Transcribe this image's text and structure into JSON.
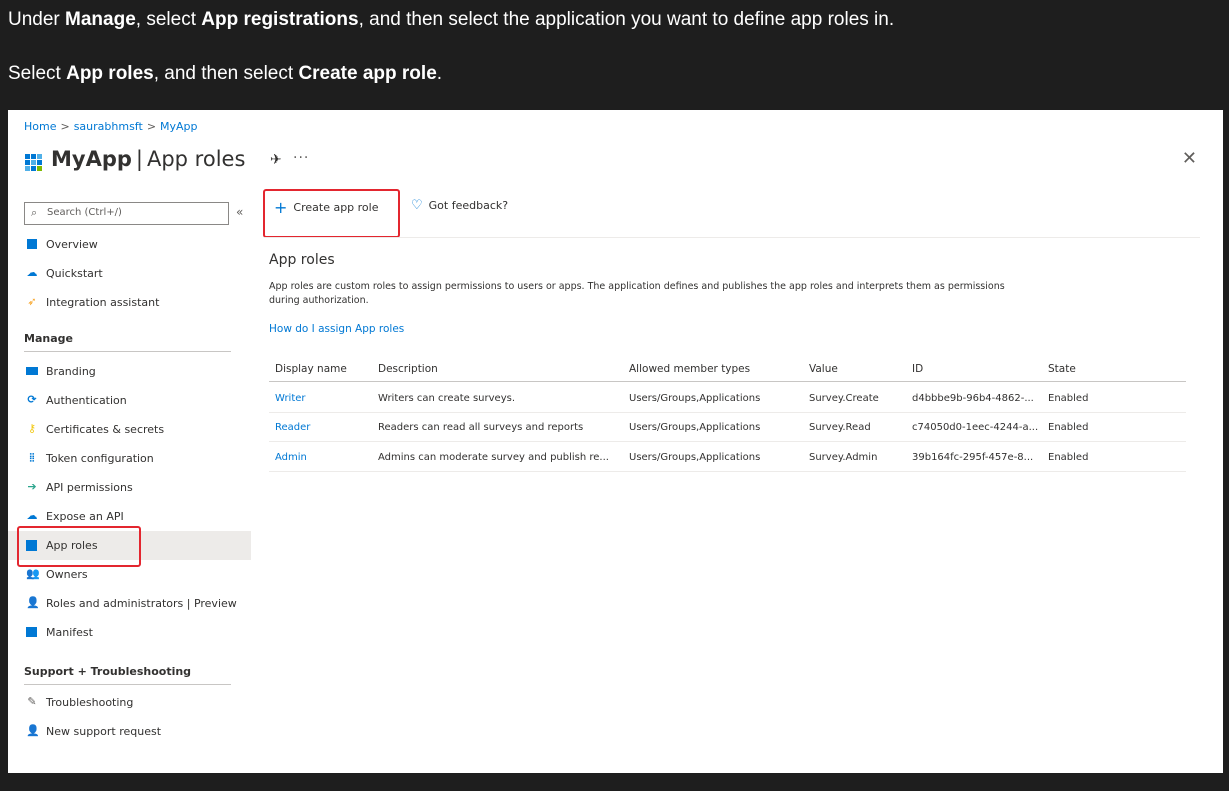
{
  "instructions": {
    "line1": {
      "p1": "Under ",
      "b1": "Manage",
      "p2": ", select ",
      "b2": "App registrations",
      "p3": ", and then select the application you want to define app roles in."
    },
    "line2": {
      "p1": "Select ",
      "b1": "App roles",
      "p2": ", and then select ",
      "b2": "Create app role",
      "p3": "."
    }
  },
  "breadcrumb": [
    "Home",
    "saurabhmsft",
    "MyApp"
  ],
  "breadcrumb_sep": ">",
  "title": {
    "app": "MyApp",
    "sep": "|",
    "page": "App roles"
  },
  "header_icons": {
    "pin": "pin-icon",
    "more": "more-icon",
    "close": "close-icon"
  },
  "sidebar": {
    "search_placeholder": "Search (Ctrl+/)",
    "collapse": "«",
    "top_items": [
      {
        "label": "Overview",
        "icon": "overview-icon"
      },
      {
        "label": "Quickstart",
        "icon": "quickstart-icon"
      },
      {
        "label": "Integration assistant",
        "icon": "rocket-icon"
      }
    ],
    "manage_heading": "Manage",
    "manage_items": [
      {
        "label": "Branding",
        "icon": "branding-icon"
      },
      {
        "label": "Authentication",
        "icon": "authentication-icon"
      },
      {
        "label": "Certificates & secrets",
        "icon": "key-icon"
      },
      {
        "label": "Token configuration",
        "icon": "token-icon"
      },
      {
        "label": "API permissions",
        "icon": "api-permissions-icon"
      },
      {
        "label": "Expose an API",
        "icon": "cloud-icon"
      },
      {
        "label": "App roles",
        "icon": "app-roles-icon",
        "selected": true
      },
      {
        "label": "Owners",
        "icon": "owners-icon"
      },
      {
        "label": "Roles and administrators | Preview",
        "icon": "roles-admin-icon"
      },
      {
        "label": "Manifest",
        "icon": "manifest-icon"
      }
    ],
    "support_heading": "Support + Troubleshooting",
    "support_items": [
      {
        "label": "Troubleshooting",
        "icon": "wrench-icon"
      },
      {
        "label": "New support request",
        "icon": "support-person-icon"
      }
    ]
  },
  "commands": {
    "create_label": "Create app role",
    "feedback_label": "Got feedback?"
  },
  "main": {
    "section_title": "App roles",
    "description": "App roles are custom roles to assign permissions to users or apps. The application defines and publishes the app roles and interprets them as permissions during authorization.",
    "help_link": "How do I assign App roles"
  },
  "table": {
    "headers": [
      "Display name",
      "Description",
      "Allowed member types",
      "Value",
      "ID",
      "State"
    ],
    "rows": [
      [
        "Writer",
        "Writers can create surveys.",
        "Users/Groups,Applications",
        "Survey.Create",
        "d4bbbe9b-96b4-4862-...",
        "Enabled"
      ],
      [
        "Reader",
        "Readers can read all surveys and reports",
        "Users/Groups,Applications",
        "Survey.Read",
        "c74050d0-1eec-4244-a...",
        "Enabled"
      ],
      [
        "Admin",
        "Admins can moderate survey and publish re...",
        "Users/Groups,Applications",
        "Survey.Admin",
        "39b164fc-295f-457e-8...",
        "Enabled"
      ]
    ]
  },
  "colors": {
    "accent": "#0078d4",
    "highlight": "#e3262f",
    "selected_bg": "#edebe9"
  }
}
